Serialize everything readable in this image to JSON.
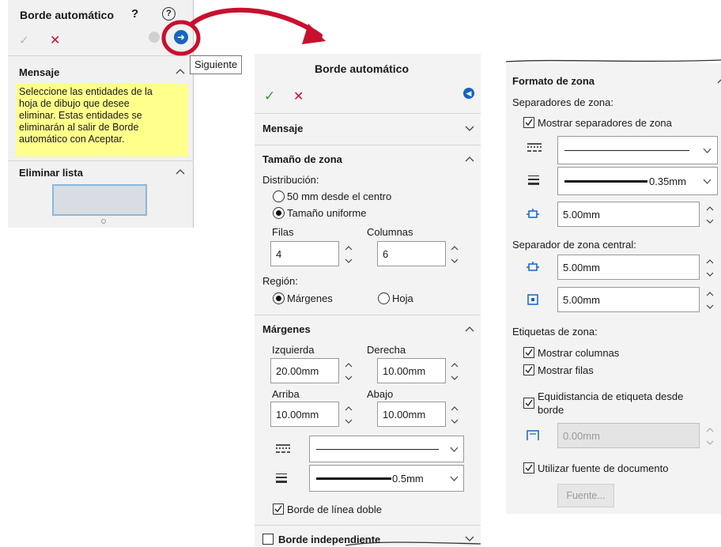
{
  "panel1": {
    "title": "Borde automático",
    "tooltip": "Siguiente",
    "mensaje_header": "Mensaje",
    "mensaje_text": [
      "Seleccione las entidades de la",
      "hoja de dibujo que desee",
      "eliminar. Estas entidades se",
      "eliminarán al salir de Borde",
      "automático con Aceptar."
    ],
    "eliminar_header": "Eliminar lista"
  },
  "panel2": {
    "title": "Borde automático",
    "mensaje_header": "Mensaje",
    "tamano_header": "Tamaño de zona",
    "distribucion_label": "Distribución:",
    "radio_centro": "50 mm desde el centro",
    "radio_uniforme": "Tamaño uniforme",
    "filas_label": "Filas",
    "columnas_label": "Columnas",
    "filas_value": "4",
    "columnas_value": "6",
    "region_label": "Región:",
    "radio_margenes": "Márgenes",
    "radio_hoja": "Hoja",
    "margenes_header": "Márgenes",
    "izquierda_label": "Izquierda",
    "derecha_label": "Derecha",
    "izquierda_value": "20.00mm",
    "derecha_value": "10.00mm",
    "arriba_label": "Arriba",
    "abajo_label": "Abajo",
    "arriba_value": "10.00mm",
    "abajo_value": "10.00mm",
    "line_weight": "0.5mm",
    "doble_label": "Borde de línea doble",
    "independiente_label": "Borde independiente"
  },
  "panel3": {
    "formato_header": "Formato de zona",
    "separadores_label": "Separadores de zona:",
    "mostrar_sep": "Mostrar separadores de zona",
    "line_weight": "0.35mm",
    "sep_value": "5.00mm",
    "central_label": "Separador de zona central:",
    "central_value1": "5.00mm",
    "central_value2": "5.00mm",
    "etiquetas_label": "Etiquetas de zona:",
    "mostrar_columnas": "Mostrar columnas",
    "mostrar_filas": "Mostrar filas",
    "equidistancia_1": "Equidistancia de etiqueta desde",
    "equidistancia_2": "borde",
    "equi_value": "0.00mm",
    "fuente_doc": "Utilizar fuente de documento",
    "fuente_button": "Fuente..."
  },
  "colors": {
    "panel_bg": "#f1f1f1",
    "message_bg": "#ffff8c",
    "accent_red": "#c8102e",
    "check_green": "#2e9e2e",
    "next_blue": "#1565c0"
  }
}
